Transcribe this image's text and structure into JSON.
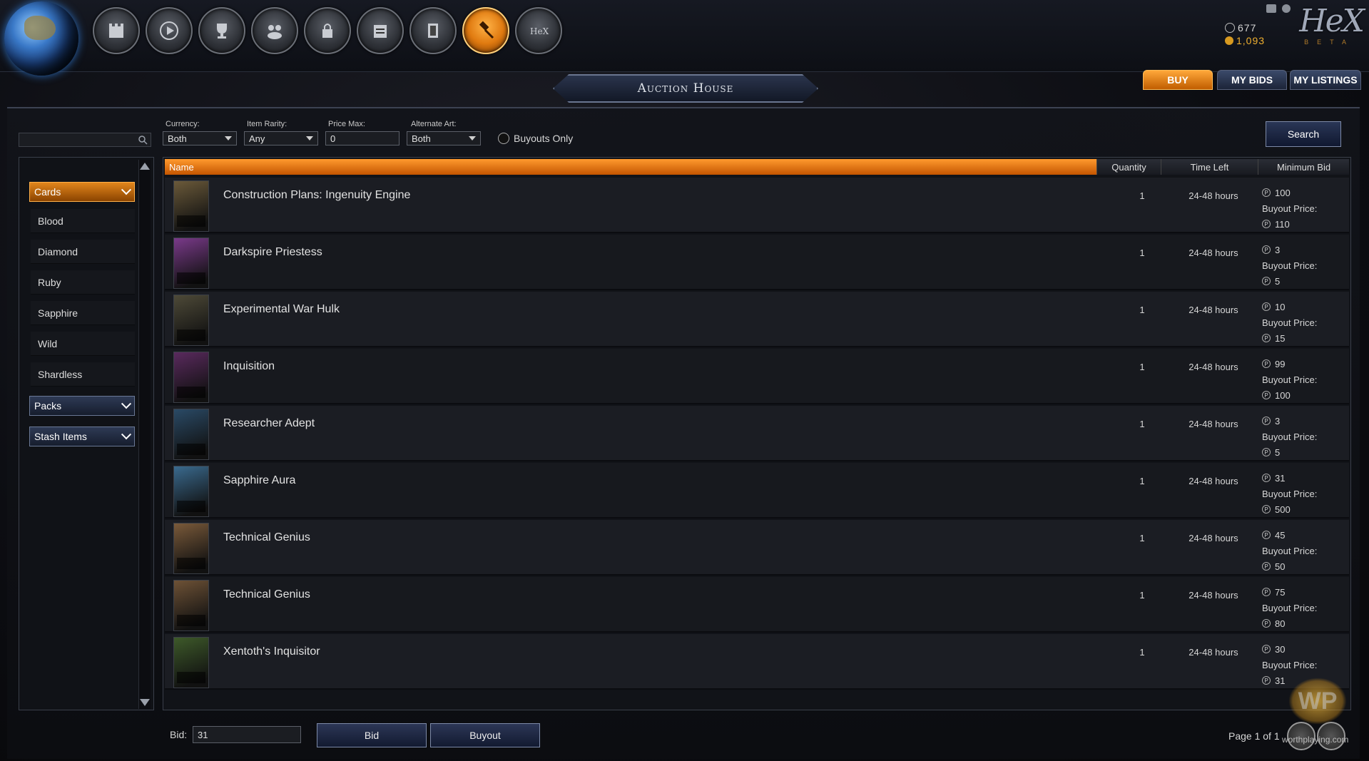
{
  "header": {
    "nav_icons": [
      "castle-icon",
      "play-icon",
      "trophy-icon",
      "community-icon",
      "lock-icon",
      "store-icon",
      "collection-icon",
      "auction-gavel-icon",
      "hex-icon"
    ],
    "active_nav": "auction-gavel-icon",
    "platinum": "677",
    "gold": "1,093",
    "logo": "HeX",
    "logo_sub": "BETA"
  },
  "tabs": [
    {
      "label": "BUY",
      "active": true
    },
    {
      "label": "MY BIDS",
      "active": false
    },
    {
      "label": "MY LISTINGS",
      "active": false
    }
  ],
  "title": "Auction House",
  "filters": {
    "search_placeholder": "",
    "currency_label": "Currency:",
    "currency_value": "Both",
    "rarity_label": "Item Rarity:",
    "rarity_value": "Any",
    "pricemax_label": "Price Max:",
    "pricemax_value": "0",
    "altart_label": "Alternate Art:",
    "altart_value": "Both",
    "buyouts_only_label": "Buyouts Only",
    "search_button": "Search"
  },
  "sidebar": {
    "cards_label": "Cards",
    "items": [
      "Blood",
      "Diamond",
      "Ruby",
      "Sapphire",
      "Wild",
      "Shardless"
    ],
    "packs_label": "Packs",
    "stash_label": "Stash Items"
  },
  "table": {
    "headers": {
      "name": "Name",
      "quantity": "Quantity",
      "time_left": "Time Left",
      "min_bid": "Minimum Bid"
    },
    "buyout_label": "Buyout Price:",
    "rows": [
      {
        "name": "Construction Plans: Ingenuity Engine",
        "quantity": "1",
        "time_left": "24-48 hours",
        "min_bid": "100",
        "buyout": "110",
        "thumb_color": "#6b5a3a"
      },
      {
        "name": "Darkspire Priestess",
        "quantity": "1",
        "time_left": "24-48 hours",
        "min_bid": "3",
        "buyout": "5",
        "thumb_color": "#7a3a8a"
      },
      {
        "name": "Experimental War Hulk",
        "quantity": "1",
        "time_left": "24-48 hours",
        "min_bid": "10",
        "buyout": "15",
        "thumb_color": "#4e4a38"
      },
      {
        "name": "Inquisition",
        "quantity": "1",
        "time_left": "24-48 hours",
        "min_bid": "99",
        "buyout": "100",
        "thumb_color": "#5a2a5e"
      },
      {
        "name": "Researcher Adept",
        "quantity": "1",
        "time_left": "24-48 hours",
        "min_bid": "3",
        "buyout": "5",
        "thumb_color": "#2a4a66"
      },
      {
        "name": "Sapphire Aura",
        "quantity": "1",
        "time_left": "24-48 hours",
        "min_bid": "31",
        "buyout": "500",
        "thumb_color": "#3a6a8e"
      },
      {
        "name": "Technical Genius",
        "quantity": "1",
        "time_left": "24-48 hours",
        "min_bid": "45",
        "buyout": "50",
        "thumb_color": "#7a5a3a"
      },
      {
        "name": "Technical Genius",
        "quantity": "1",
        "time_left": "24-48 hours",
        "min_bid": "75",
        "buyout": "80",
        "thumb_color": "#6e5236"
      },
      {
        "name": "Xentoth's Inquisitor",
        "quantity": "1",
        "time_left": "24-48 hours",
        "min_bid": "30",
        "buyout": "31",
        "thumb_color": "#3e5a2a"
      }
    ]
  },
  "footer": {
    "bid_label": "Bid:",
    "bid_value": "31",
    "bid_button": "Bid",
    "buyout_button": "Buyout",
    "page_info": "Page 1 of 1",
    "watermark": "worthplaying.com",
    "watermark_logo": "WP"
  }
}
